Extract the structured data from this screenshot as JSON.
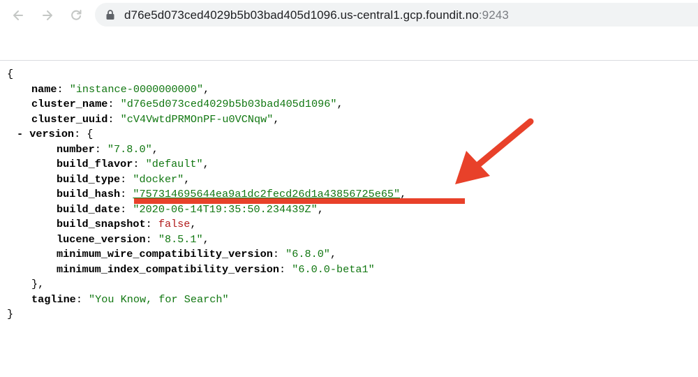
{
  "browser": {
    "url_main": "d76e5d073ced4029b5b03bad405d1096.us-central1.gcp.foundit.no",
    "url_port": ":9243"
  },
  "json": {
    "open_brace": "{",
    "close_brace": "}",
    "name_key": "name",
    "name_value": "\"instance-0000000000\"",
    "cluster_name_key": "cluster_name",
    "cluster_name_value": "\"d76e5d073ced4029b5b03bad405d1096\"",
    "cluster_uuid_key": "cluster_uuid",
    "cluster_uuid_value": "\"cV4VwtdPRMOnPF-u0VCNqw\"",
    "version_toggle": "-",
    "version_key": "version",
    "version_close": "},",
    "version": [
      {
        "key": "number",
        "value": "\"7.8.0\"",
        "type": "string",
        "comma": ","
      },
      {
        "key": "build_flavor",
        "value": "\"default\"",
        "type": "string",
        "comma": ","
      },
      {
        "key": "build_type",
        "value": "\"docker\"",
        "type": "string",
        "comma": ","
      },
      {
        "key": "build_hash",
        "value": "\"757314695644ea9a1dc2fecd26d1a43856725e65\"",
        "type": "string",
        "comma": ","
      },
      {
        "key": "build_date",
        "value": "\"2020-06-14T19:35:50.234439Z\"",
        "type": "string",
        "comma": ","
      },
      {
        "key": "build_snapshot",
        "value": "false",
        "type": "boolean",
        "comma": ","
      },
      {
        "key": "lucene_version",
        "value": "\"8.5.1\"",
        "type": "string",
        "comma": ","
      },
      {
        "key": "minimum_wire_compatibility_version",
        "value": "\"6.8.0\"",
        "type": "string",
        "comma": ","
      },
      {
        "key": "minimum_index_compatibility_version",
        "value": "\"6.0.0-beta1\"",
        "type": "string",
        "comma": ""
      }
    ],
    "tagline_key": "tagline",
    "tagline_value": "\"You Know, for Search\""
  },
  "colors": {
    "string": "#117711",
    "boolean": "#b11c1c",
    "annotation": "#e8412a"
  },
  "icons": [
    "back-arrow-icon",
    "forward-arrow-icon",
    "reload-icon",
    "lock-icon",
    "annotation-arrow-icon"
  ]
}
